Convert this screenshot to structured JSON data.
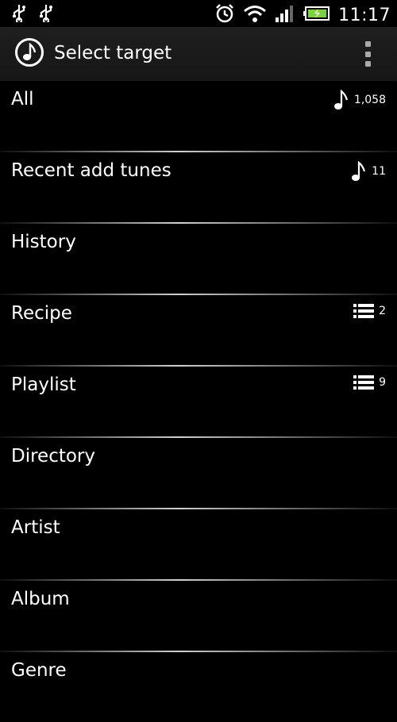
{
  "statusbar": {
    "time": "11:17",
    "icons": [
      "usb-icon",
      "usb-icon",
      "alarm-icon",
      "wifi-icon",
      "signal-icon",
      "battery-icon"
    ]
  },
  "appbar": {
    "title": "Select target",
    "logo_icon": "music-note-icon",
    "overflow_icon": "overflow-menu-icon"
  },
  "list": {
    "items": [
      {
        "label": "All",
        "count": "1,058",
        "icon": "music-note-icon"
      },
      {
        "label": "Recent add tunes",
        "count": "11",
        "icon": "music-note-icon"
      },
      {
        "label": "History"
      },
      {
        "label": "Recipe",
        "count": "2",
        "icon": "list-icon"
      },
      {
        "label": "Playlist",
        "count": "9",
        "icon": "list-icon"
      },
      {
        "label": "Directory"
      },
      {
        "label": "Artist"
      },
      {
        "label": "Album"
      },
      {
        "label": "Genre"
      }
    ]
  }
}
